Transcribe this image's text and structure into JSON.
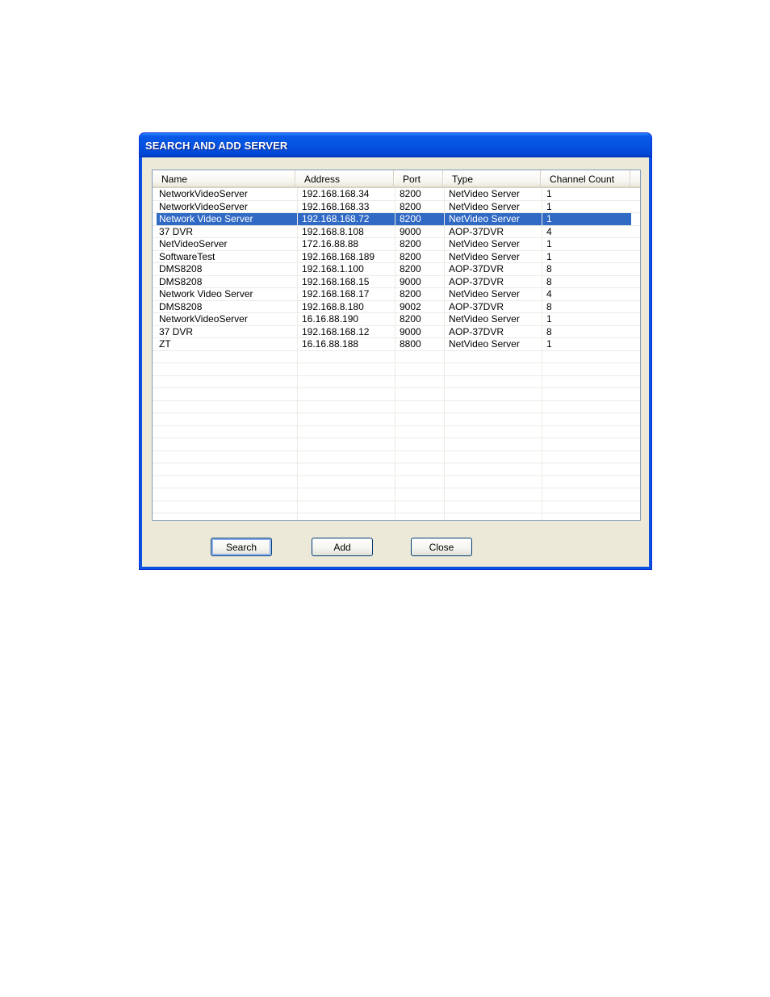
{
  "window": {
    "title": "SEARCH AND ADD SERVER"
  },
  "table": {
    "columns": [
      "Name",
      "Address",
      "Port",
      "Type",
      "Channel Count"
    ],
    "selected_row": 2,
    "rows": [
      [
        "NetworkVideoServer",
        "192.168.168.34",
        "8200",
        "NetVideo Server",
        "1"
      ],
      [
        "NetworkVideoServer",
        "192.168.168.33",
        "8200",
        "NetVideo Server",
        "1"
      ],
      [
        "Network Video Server",
        "192.168.168.72",
        "8200",
        "NetVideo Server",
        "1"
      ],
      [
        "37 DVR",
        "192.168.8.108",
        "9000",
        "AOP-37DVR",
        "4"
      ],
      [
        "NetVideoServer",
        "172.16.88.88",
        "8200",
        "NetVideo Server",
        "1"
      ],
      [
        "SoftwareTest",
        "192.168.168.189",
        "8200",
        "NetVideo Server",
        "1"
      ],
      [
        "DMS8208",
        "192.168.1.100",
        "8200",
        "AOP-37DVR",
        "8"
      ],
      [
        "DMS8208",
        "192.168.168.15",
        "9000",
        "AOP-37DVR",
        "8"
      ],
      [
        "Network Video Server",
        "192.168.168.17",
        "8200",
        "NetVideo Server",
        "4"
      ],
      [
        "DMS8208",
        "192.168.8.180",
        "9002",
        "AOP-37DVR",
        "8"
      ],
      [
        "NetworkVideoServer",
        "16.16.88.190",
        "8200",
        "NetVideo Server",
        "1"
      ],
      [
        "37 DVR",
        "192.168.168.12",
        "9000",
        "AOP-37DVR",
        "8"
      ],
      [
        "ZT",
        "16.16.88.188",
        "8800",
        "NetVideo Server",
        "1"
      ]
    ]
  },
  "buttons": {
    "search": "Search",
    "add": "Add",
    "close": "Close"
  },
  "colors": {
    "titlebar": "#0553e0",
    "selection": "#316ac5",
    "dialog_face": "#ece9d8"
  }
}
